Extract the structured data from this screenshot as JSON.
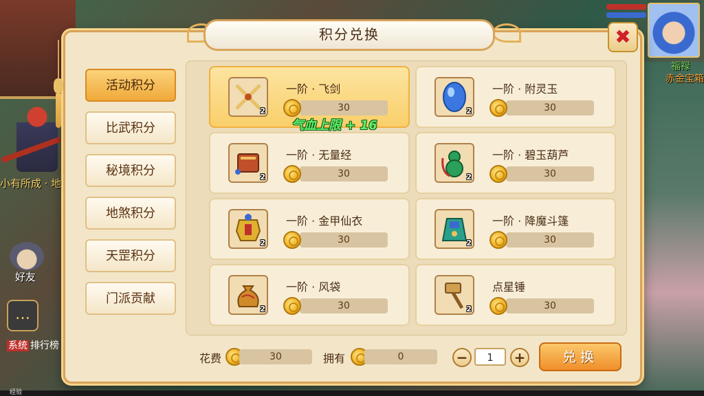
{
  "background": {
    "left_text": "小有所成 · 地",
    "friend_label": "好友",
    "chat_tag": "系统",
    "chat_text": "排行榜",
    "player_name": "福禄",
    "player_title": "赤金宝箱",
    "bottom_label": "经验"
  },
  "dialog": {
    "title": "积分兑换",
    "close_icon": "✖"
  },
  "tabs": [
    {
      "label": "活动积分",
      "active": true
    },
    {
      "label": "比武积分",
      "active": false
    },
    {
      "label": "秘境积分",
      "active": false
    },
    {
      "label": "地煞积分",
      "active": false
    },
    {
      "label": "天罡积分",
      "active": false
    },
    {
      "label": "门派贡献",
      "active": false
    }
  ],
  "items": [
    {
      "name": "一阶 · 飞剑",
      "price": "30",
      "count": "2",
      "icon": "flying-sword-icon",
      "selected": true
    },
    {
      "name": "一阶 · 附灵玉",
      "price": "30",
      "count": "2",
      "icon": "spirit-jade-icon",
      "selected": false
    },
    {
      "name": "一阶 · 无量经",
      "price": "30",
      "count": "2",
      "icon": "scripture-scroll-icon",
      "selected": false
    },
    {
      "name": "一阶 · 碧玉葫芦",
      "price": "30",
      "count": "2",
      "icon": "jade-gourd-icon",
      "selected": false
    },
    {
      "name": "一阶 · 金甲仙衣",
      "price": "30",
      "count": "2",
      "icon": "golden-armor-icon",
      "selected": false
    },
    {
      "name": "一阶 · 降魔斗篷",
      "price": "30",
      "count": "2",
      "icon": "demon-cloak-icon",
      "selected": false
    },
    {
      "name": "一阶 · 风袋",
      "price": "30",
      "count": "2",
      "icon": "wind-bag-icon",
      "selected": false
    },
    {
      "name": "点星锤",
      "price": "30",
      "count": "2",
      "icon": "star-hammer-icon",
      "selected": false
    }
  ],
  "float_text": "气血上限 + 16",
  "footer": {
    "cost_label": "花费",
    "cost_value": "30",
    "own_label": "拥有",
    "own_value": "0",
    "quantity": "1",
    "minus": "−",
    "plus": "+",
    "exchange_label": "兑换"
  },
  "colors": {
    "accent": "#f0a93a",
    "panel": "#f3e6c8",
    "border": "#d9a35a",
    "close": "#d0202a"
  }
}
